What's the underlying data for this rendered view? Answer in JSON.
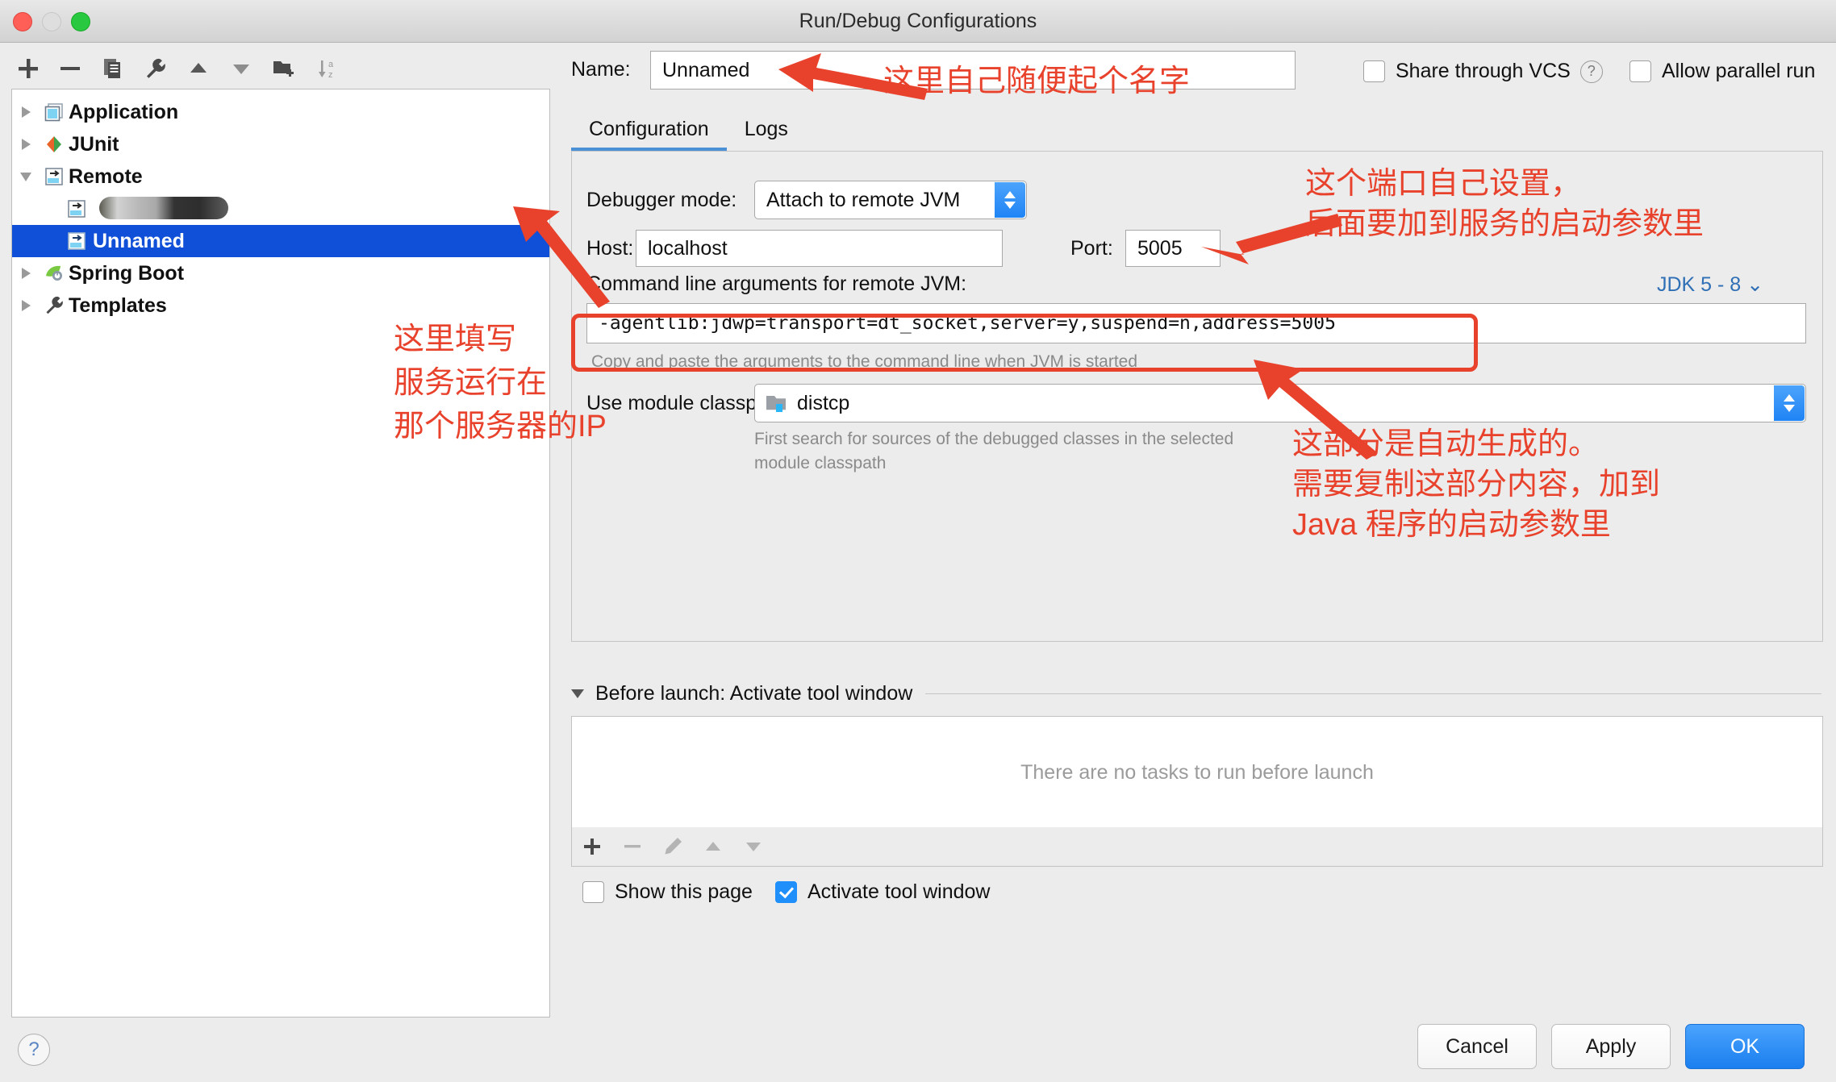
{
  "window": {
    "title": "Run/Debug Configurations",
    "traffic_lights": [
      "close",
      "minimize",
      "maximize"
    ]
  },
  "tree_toolbar": {
    "buttons": [
      {
        "name": "add",
        "icon": "plus-icon"
      },
      {
        "name": "remove",
        "icon": "minus-icon"
      },
      {
        "name": "copy",
        "icon": "copy-icon"
      },
      {
        "name": "edit-templates",
        "icon": "wrench-icon"
      },
      {
        "name": "move-up",
        "icon": "arrow-up-icon"
      },
      {
        "name": "move-down",
        "icon": "arrow-down-icon"
      },
      {
        "name": "create-folder",
        "icon": "folder-add-icon"
      },
      {
        "name": "sort-alphabetically",
        "icon": "sort-az-icon"
      }
    ]
  },
  "tree": {
    "items": [
      {
        "label": "Application",
        "icon": "application-icon",
        "expander": "collapsed",
        "level": 0,
        "selected": false
      },
      {
        "label": "JUnit",
        "icon": "junit-icon",
        "expander": "collapsed",
        "level": 0,
        "selected": false
      },
      {
        "label": "Remote",
        "icon": "remote-icon",
        "expander": "expanded",
        "level": 0,
        "selected": false
      },
      {
        "label": "",
        "icon": "remote-icon",
        "expander": "none",
        "level": 1,
        "selected": false,
        "redacted": true
      },
      {
        "label": "Unnamed",
        "icon": "remote-icon",
        "expander": "none",
        "level": 1,
        "selected": true
      },
      {
        "label": "Spring Boot",
        "icon": "spring-boot-icon",
        "expander": "collapsed",
        "level": 0,
        "selected": false
      },
      {
        "label": "Templates",
        "icon": "wrench-icon",
        "expander": "collapsed",
        "level": 0,
        "selected": false
      }
    ]
  },
  "form": {
    "name_label": "Name:",
    "name_value": "Unnamed",
    "share_through_vcs": {
      "label": "Share through VCS",
      "checked": false,
      "help": "?"
    },
    "allow_parallel_run": {
      "label": "Allow parallel run",
      "checked": false
    },
    "tabs": [
      {
        "label": "Configuration",
        "active": true
      },
      {
        "label": "Logs",
        "active": false
      }
    ],
    "debugger_mode_label": "Debugger mode:",
    "debugger_mode_value": "Attach to remote JVM",
    "host_label": "Host:",
    "host_value": "localhost",
    "port_label": "Port:",
    "port_value": "5005",
    "cmdline_label": "Command line arguments for remote JVM:",
    "cmdline_value": "-agentlib:jdwp=transport=dt_socket,server=y,suspend=n,address=5005",
    "cmdline_hint": "Copy and paste the arguments to the command line when JVM is started",
    "jdk_selector": "JDK 5 - 8",
    "module_classpath_label": "Use module classpath:",
    "module_classpath_value": "distcp",
    "module_classpath_hint_line1": "First search for sources of the debugged classes in the selected",
    "module_classpath_hint_line2": "module classpath"
  },
  "before_launch": {
    "header": "Before launch: Activate tool window",
    "empty_text": "There are no tasks to run before launch",
    "toolbar": [
      {
        "name": "add-task",
        "icon": "plus-icon"
      },
      {
        "name": "remove-task",
        "icon": "minus-icon"
      },
      {
        "name": "edit-task",
        "icon": "pencil-icon"
      },
      {
        "name": "move-task-up",
        "icon": "arrow-up-icon"
      },
      {
        "name": "move-task-down",
        "icon": "arrow-down-icon"
      }
    ],
    "show_this_page": {
      "label": "Show this page",
      "checked": false
    },
    "activate_tool_window": {
      "label": "Activate tool window",
      "checked": true
    }
  },
  "footer": {
    "help": "?",
    "cancel": "Cancel",
    "apply": "Apply",
    "ok": "OK"
  },
  "annotations": [
    {
      "id": "name",
      "text": "这里自己随便起个名字"
    },
    {
      "id": "port_line1",
      "text": "这个端口自己设置，"
    },
    {
      "id": "port_line2",
      "text": "后面要加到服务的启动参数里"
    },
    {
      "id": "host_line1",
      "text": "这里填写"
    },
    {
      "id": "host_line2",
      "text": "服务运行在"
    },
    {
      "id": "host_line3",
      "text": "那个服务器的IP"
    },
    {
      "id": "cmd_line1",
      "text": "这部分是自动生成的。"
    },
    {
      "id": "cmd_line2",
      "text": "需要复制这部分内容，加到"
    },
    {
      "id": "cmd_line3",
      "text": "Java 程序的启动参数里"
    }
  ],
  "colors": {
    "annotation_red": "#e8422c",
    "selection_blue": "#1050d8",
    "accent_blue": "#1e8ffb",
    "link_blue": "#2f6fb5"
  }
}
